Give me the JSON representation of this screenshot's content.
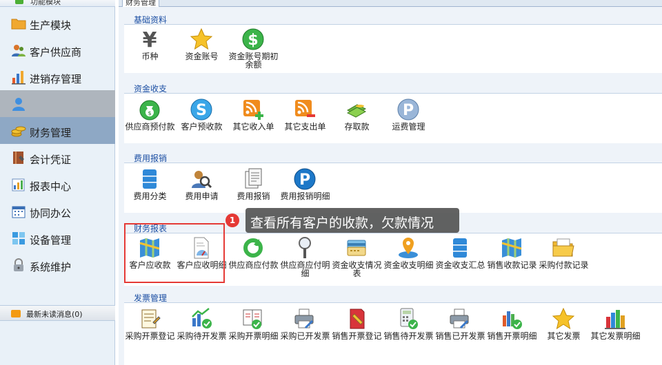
{
  "sidebar": {
    "header": "功能模块",
    "items": [
      {
        "label": "生产模块",
        "icon": "folder-icon"
      },
      {
        "label": "客户供应商",
        "icon": "users-icon"
      },
      {
        "label": "进销存管理",
        "icon": "bar-chart-icon"
      },
      {
        "label": "",
        "icon": "person-icon"
      },
      {
        "label": "财务管理",
        "icon": "coins-icon"
      },
      {
        "label": "会计凭证",
        "icon": "book-icon"
      },
      {
        "label": "报表中心",
        "icon": "report-icon"
      },
      {
        "label": "协同办公",
        "icon": "calendar-icon"
      },
      {
        "label": "设备管理",
        "icon": "window-icon"
      },
      {
        "label": "系统维护",
        "icon": "lock-icon"
      }
    ],
    "messages": "最新未读消息(0)"
  },
  "main": {
    "tab": "财务管理",
    "sections": [
      {
        "title": "基础资料",
        "tiles": [
          {
            "label": "币种",
            "icon": "yen-icon"
          },
          {
            "label": "资金账号",
            "icon": "star-icon"
          },
          {
            "label": "资金账号期初余额",
            "icon": "dollar-icon"
          }
        ]
      },
      {
        "title": "资金收支",
        "tiles": [
          {
            "label": "供应商预付款",
            "icon": "money-bag-icon"
          },
          {
            "label": "客户预收款",
            "icon": "s-coin-icon"
          },
          {
            "label": "其它收入单",
            "icon": "rss-add-icon"
          },
          {
            "label": "其它支出单",
            "icon": "rss-remove-icon"
          },
          {
            "label": "存取款",
            "icon": "cash-icon"
          },
          {
            "label": "运费管理",
            "icon": "p-coin-icon"
          }
        ]
      },
      {
        "title": "费用报销",
        "tiles": [
          {
            "label": "费用分类",
            "icon": "database-icon"
          },
          {
            "label": "费用申请",
            "icon": "search-user-icon"
          },
          {
            "label": "费用报销",
            "icon": "documents-icon"
          },
          {
            "label": "费用报销明细",
            "icon": "paypal-icon"
          }
        ]
      },
      {
        "title": "财务报表",
        "tiles": [
          {
            "label": "客户应收款",
            "icon": "map-icon"
          },
          {
            "label": "客户应收明细",
            "icon": "report-gauge-icon"
          },
          {
            "label": "供应商应付款",
            "icon": "refresh-icon"
          },
          {
            "label": "供应商应付明细",
            "icon": "magnifier-icon"
          },
          {
            "label": "资金收支情况表",
            "icon": "card-icon"
          },
          {
            "label": "资金收支明细",
            "icon": "map-pin-icon"
          },
          {
            "label": "资金收支汇总",
            "icon": "database-icon"
          },
          {
            "label": "销售收款记录",
            "icon": "map-icon"
          },
          {
            "label": "采购付款记录",
            "icon": "folder-open-icon"
          }
        ]
      },
      {
        "title": "发票管理",
        "tiles": [
          {
            "label": "采购开票登记",
            "icon": "notepad-icon"
          },
          {
            "label": "采购待开发票",
            "icon": "chart-check-icon"
          },
          {
            "label": "采购开票明细",
            "icon": "ledger-check-icon"
          },
          {
            "label": "采购已开发票",
            "icon": "printer-icon"
          },
          {
            "label": "销售开票登记",
            "icon": "red-book-icon"
          },
          {
            "label": "销售待开发票",
            "icon": "calculator-check-icon"
          },
          {
            "label": "销售已开发票",
            "icon": "printer-icon"
          },
          {
            "label": "销售开票明细",
            "icon": "bar-check-icon"
          },
          {
            "label": "其它发票",
            "icon": "star-icon"
          },
          {
            "label": "其它发票明细",
            "icon": "books-icon"
          }
        ]
      }
    ]
  },
  "tooltip": {
    "badge": "1",
    "text": "查看所有客户的收款，欠款情况"
  },
  "colors": {
    "accent": "#1c4fa3",
    "highlight": "#e53935",
    "active_bg": "#8ea8c5"
  }
}
